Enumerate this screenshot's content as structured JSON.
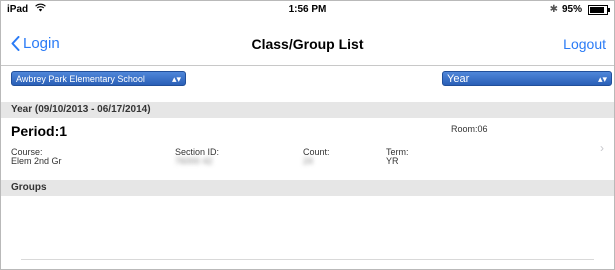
{
  "status_bar": {
    "device": "iPad",
    "time": "1:56 PM",
    "battery": "95%"
  },
  "nav": {
    "back_label": "Login",
    "title": "Class/Group List",
    "logout_label": "Logout"
  },
  "selectors": {
    "school": "Awbrey Park Elementary School",
    "term": "Year"
  },
  "year_section": {
    "header": "Year (09/10/2013 - 06/17/2014)"
  },
  "period": {
    "title": "Period:1",
    "room": "Room:06",
    "course_label": "Course:",
    "course_value": "Elem 2nd Gr",
    "section_label": "Section ID:",
    "section_value": "76000 42",
    "count_label": "Count:",
    "count_value": "24",
    "term_label": "Term:",
    "term_value": "YR"
  },
  "groups_section": {
    "header": "Groups"
  },
  "colors": {
    "accent": "#2a7bf6",
    "select_bg": "#2a5fb7",
    "section_bg": "#e6e6e6"
  }
}
